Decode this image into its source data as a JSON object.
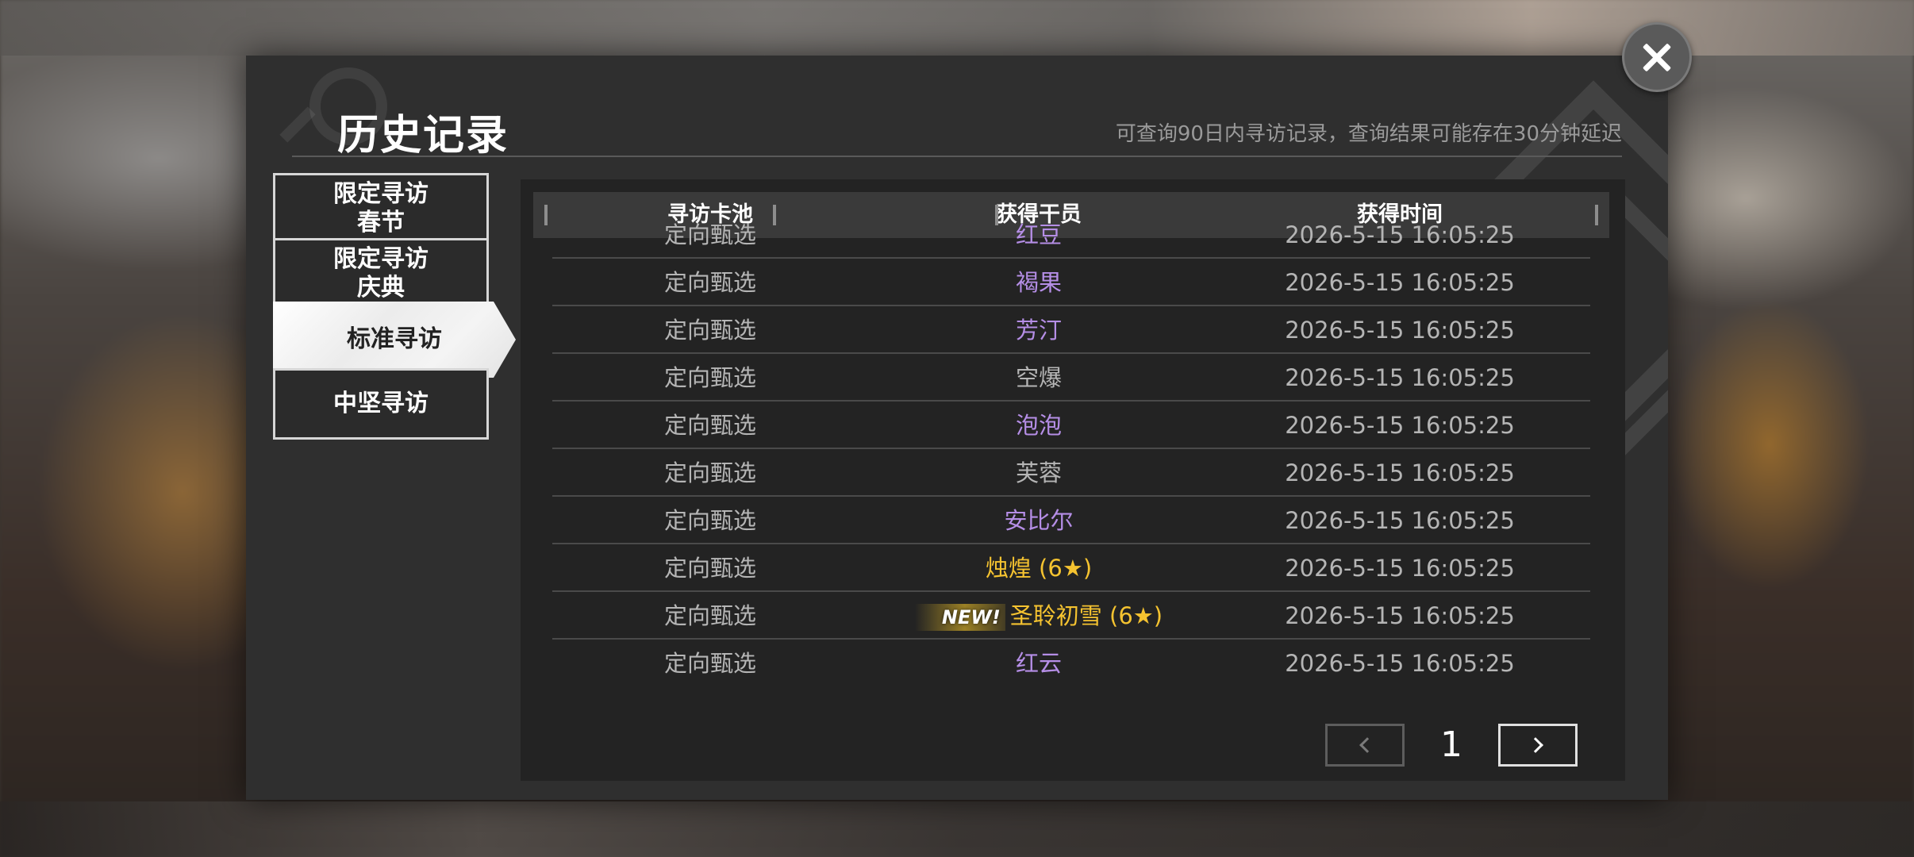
{
  "header": {
    "title": "历史记录",
    "subtitle": "可查询90日内寻访记录，查询结果可能存在30分钟延迟"
  },
  "tabs": [
    {
      "label": "限定寻访\n春节",
      "active": false
    },
    {
      "label": "限定寻访\n庆典",
      "active": false
    },
    {
      "label": "标准寻访",
      "active": true
    },
    {
      "label": "中坚寻访",
      "active": false
    }
  ],
  "table": {
    "columns": [
      "寻访卡池",
      "获得干员",
      "获得时间"
    ],
    "rows": [
      {
        "pool": "定向甄选",
        "operator": "红豆",
        "time": "2026-5-15 16:05:25",
        "color": "#b58ee6",
        "new": false
      },
      {
        "pool": "定向甄选",
        "operator": "褐果",
        "time": "2026-5-15 16:05:25",
        "color": "#b58ee6",
        "new": false
      },
      {
        "pool": "定向甄选",
        "operator": "芳汀",
        "time": "2026-5-15 16:05:25",
        "color": "#b58ee6",
        "new": false
      },
      {
        "pool": "定向甄选",
        "operator": "空爆",
        "time": "2026-5-15 16:05:25",
        "color": "#b5b5b5",
        "new": false
      },
      {
        "pool": "定向甄选",
        "operator": "泡泡",
        "time": "2026-5-15 16:05:25",
        "color": "#b58ee6",
        "new": false
      },
      {
        "pool": "定向甄选",
        "operator": "芙蓉",
        "time": "2026-5-15 16:05:25",
        "color": "#b5b5b5",
        "new": false
      },
      {
        "pool": "定向甄选",
        "operator": "安比尔",
        "time": "2026-5-15 16:05:25",
        "color": "#b58ee6",
        "new": false
      },
      {
        "pool": "定向甄选",
        "operator": "烛煌 (6★)",
        "time": "2026-5-15 16:05:25",
        "color": "#f5c330",
        "new": false
      },
      {
        "pool": "定向甄选",
        "operator": "圣聆初雪 (6★)",
        "time": "2026-5-15 16:05:25",
        "color": "#f5c330",
        "new": true
      },
      {
        "pool": "定向甄选",
        "operator": "红云",
        "time": "2026-5-15 16:05:25",
        "color": "#b58ee6",
        "new": false
      }
    ],
    "new_badge": "NEW!"
  },
  "pagination": {
    "current_page": "1"
  },
  "icons": {
    "close": "close-icon",
    "prev": "chevron-left-icon",
    "next": "chevron-right-icon"
  }
}
